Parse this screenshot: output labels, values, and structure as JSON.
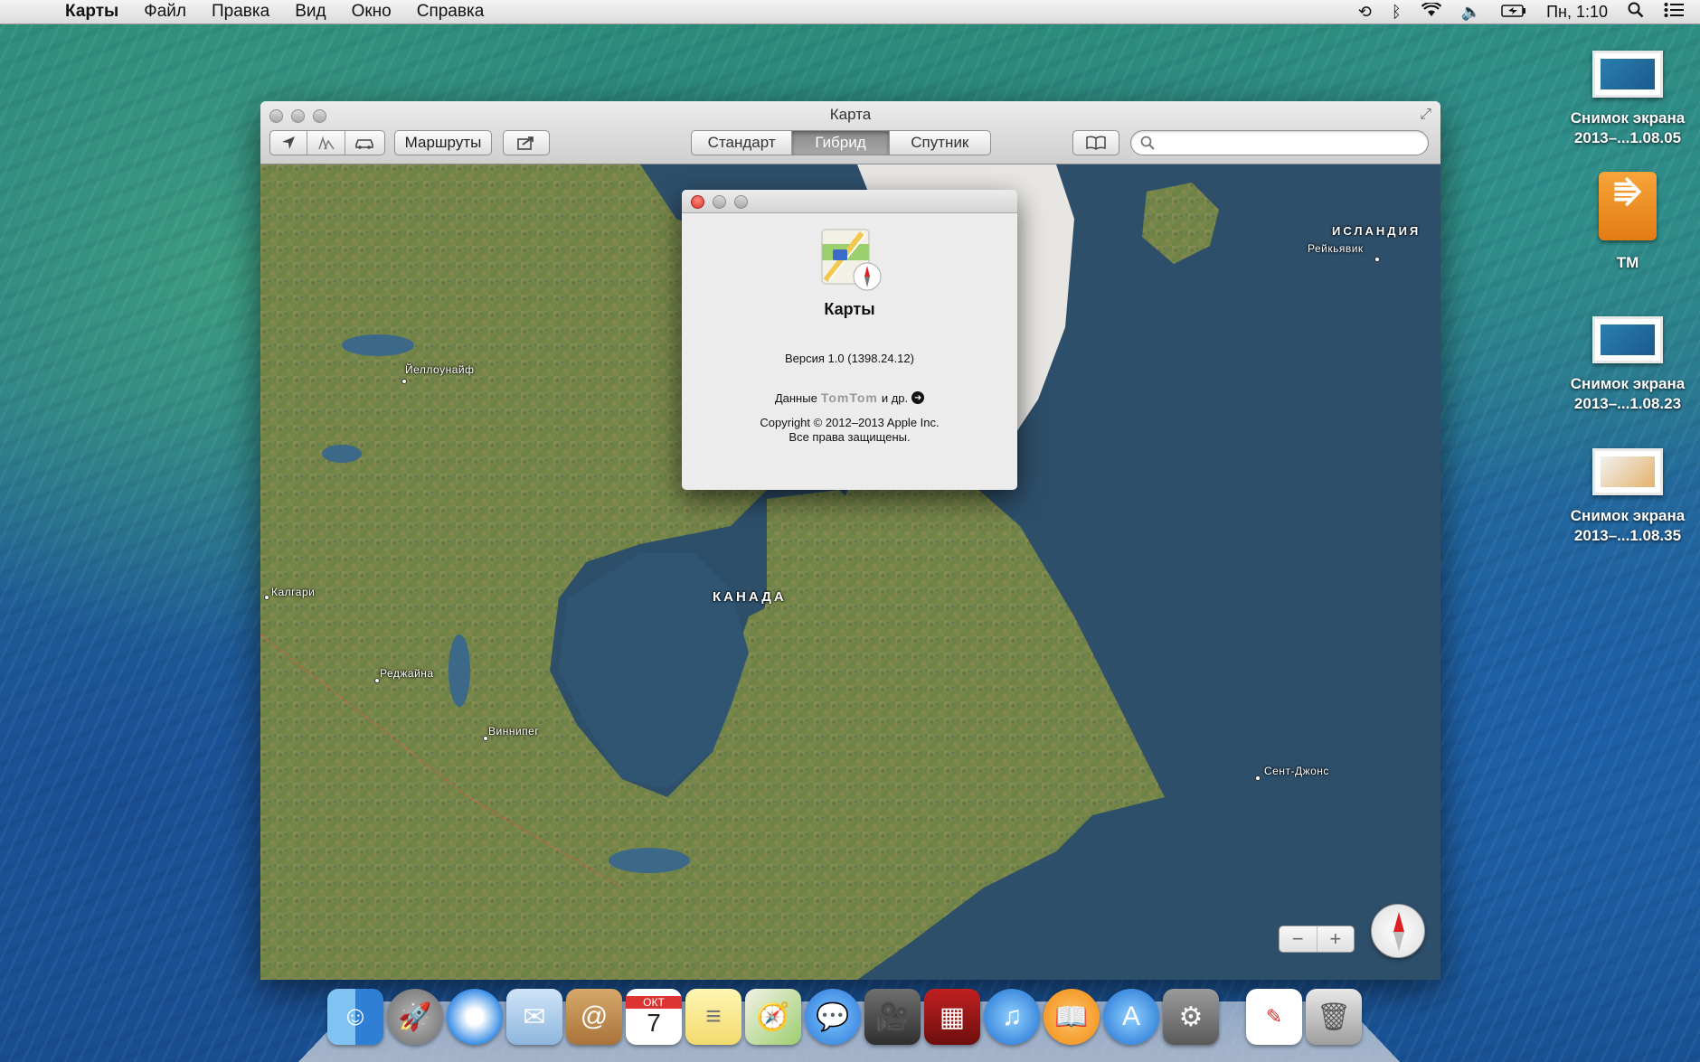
{
  "menubar": {
    "app_name": "Карты",
    "items": [
      "Файл",
      "Правка",
      "Вид",
      "Окно",
      "Справка"
    ],
    "clock": "Пн, 1:10",
    "icons": [
      "time-machine-icon",
      "bluetooth-icon",
      "wifi-icon",
      "volume-icon",
      "battery-icon",
      "spotlight-icon",
      "notification-center-icon"
    ]
  },
  "desktop": {
    "items": [
      {
        "label_line1": "Снимок экрана",
        "label_line2": "2013–...1.08.05",
        "type": "screenshot"
      },
      {
        "label_line1": "TM",
        "label_line2": "",
        "type": "drive"
      },
      {
        "label_line1": "Снимок экрана",
        "label_line2": "2013–...1.08.23",
        "type": "screenshot"
      },
      {
        "label_line1": "Снимок экрана",
        "label_line2": "2013–...1.08.35",
        "type": "screenshot"
      }
    ]
  },
  "window": {
    "title": "Карта",
    "directions_label": "Маршруты",
    "view_modes": [
      "Стандарт",
      "Гибрид",
      "Спутник"
    ],
    "active_view_mode": "Гибрид",
    "search_placeholder": ""
  },
  "map": {
    "labels": {
      "canada": "КАНАДА",
      "iceland": "ИСЛАНДИЯ",
      "reykjavik": "Рейкьявик",
      "yellowknife": "Йеллоунайф",
      "calgary": "Калгари",
      "regina": "Реджайна",
      "winnipeg": "Виннипег",
      "st_johns": "Сент-Джонс"
    },
    "zoom_out": "−",
    "zoom_in": "+"
  },
  "about": {
    "app_name": "Карты",
    "version": "Версия 1.0 (1398.24.12)",
    "data_prefix": "Данные",
    "data_provider": "TomTom",
    "data_suffix": "и др.",
    "copyright_line1": "Copyright © 2012–2013 Apple Inc.",
    "copyright_line2": "Все права защищены."
  },
  "dock": {
    "apps": [
      "finder",
      "launchpad",
      "safari",
      "mail",
      "contacts",
      "calendar",
      "notes",
      "maps",
      "messages",
      "facetime",
      "photo-booth",
      "itunes",
      "ibooks",
      "app-store",
      "system-preferences",
      "document",
      "trash"
    ],
    "calendar_month": "ОКТ",
    "calendar_day": "7"
  }
}
